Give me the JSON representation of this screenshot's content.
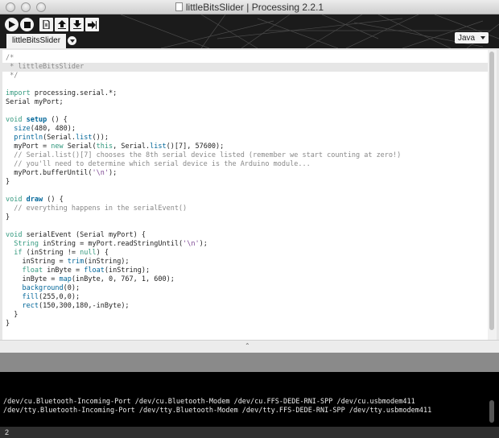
{
  "window": {
    "title": "littleBitsSlider | Processing 2.2.1"
  },
  "toolbar": {
    "buttons": [
      "run",
      "stop",
      "new",
      "open",
      "save",
      "export"
    ],
    "mode": "Java"
  },
  "tab": {
    "label": "littleBitsSlider"
  },
  "code": [
    [
      {
        "t": "/*",
        "c": "comment"
      }
    ],
    [
      {
        "t": " * littleBitsSlider",
        "c": "comment"
      }
    ],
    [
      {
        "t": " */",
        "c": "comment"
      }
    ],
    [],
    [
      {
        "t": "import",
        "c": "kw"
      },
      {
        "t": " processing.serial.*;",
        "c": "plain"
      }
    ],
    [
      {
        "t": "Serial myPort;",
        "c": "plain"
      }
    ],
    [],
    [
      {
        "t": "void",
        "c": "kw"
      },
      {
        "t": " ",
        "c": "plain"
      },
      {
        "t": "setup",
        "c": "fn"
      },
      {
        "t": " () {",
        "c": "plain"
      }
    ],
    [
      {
        "t": "  ",
        "c": "plain"
      },
      {
        "t": "size",
        "c": "builtin"
      },
      {
        "t": "(480, 480);",
        "c": "plain"
      }
    ],
    [
      {
        "t": "  ",
        "c": "plain"
      },
      {
        "t": "println",
        "c": "builtin"
      },
      {
        "t": "(Serial.",
        "c": "plain"
      },
      {
        "t": "list",
        "c": "builtin"
      },
      {
        "t": "());",
        "c": "plain"
      }
    ],
    [
      {
        "t": "  myPort = ",
        "c": "plain"
      },
      {
        "t": "new",
        "c": "kw"
      },
      {
        "t": " Serial(",
        "c": "plain"
      },
      {
        "t": "this",
        "c": "kw"
      },
      {
        "t": ", Serial.",
        "c": "plain"
      },
      {
        "t": "list",
        "c": "builtin"
      },
      {
        "t": "()[7], 57600);",
        "c": "plain"
      }
    ],
    [
      {
        "t": "  // Serial.list()[7] chooses the 8th serial device listed (remember we start counting at zero!)",
        "c": "comment"
      }
    ],
    [
      {
        "t": "  // you'll need to determine which serial device is the Arduino module...",
        "c": "comment"
      }
    ],
    [
      {
        "t": "  myPort.bufferUntil(",
        "c": "plain"
      },
      {
        "t": "'\\n'",
        "c": "str"
      },
      {
        "t": ");",
        "c": "plain"
      }
    ],
    [
      {
        "t": "}",
        "c": "plain"
      }
    ],
    [],
    [
      {
        "t": "void",
        "c": "kw"
      },
      {
        "t": " ",
        "c": "plain"
      },
      {
        "t": "draw",
        "c": "fn"
      },
      {
        "t": " () {",
        "c": "plain"
      }
    ],
    [
      {
        "t": "  // everything happens in the serialEvent()",
        "c": "comment"
      }
    ],
    [
      {
        "t": "}",
        "c": "plain"
      }
    ],
    [],
    [
      {
        "t": "void",
        "c": "kw"
      },
      {
        "t": " serialEvent (Serial myPort) {",
        "c": "plain"
      }
    ],
    [
      {
        "t": "  ",
        "c": "plain"
      },
      {
        "t": "String",
        "c": "kw"
      },
      {
        "t": " inString = myPort.readStringUntil(",
        "c": "plain"
      },
      {
        "t": "'\\n'",
        "c": "str"
      },
      {
        "t": ");",
        "c": "plain"
      }
    ],
    [
      {
        "t": "  ",
        "c": "plain"
      },
      {
        "t": "if",
        "c": "kw"
      },
      {
        "t": " (inString != ",
        "c": "plain"
      },
      {
        "t": "null",
        "c": "kw"
      },
      {
        "t": ") {",
        "c": "plain"
      }
    ],
    [
      {
        "t": "    inString = ",
        "c": "plain"
      },
      {
        "t": "trim",
        "c": "builtin"
      },
      {
        "t": "(inString);",
        "c": "plain"
      }
    ],
    [
      {
        "t": "    ",
        "c": "plain"
      },
      {
        "t": "float",
        "c": "kw"
      },
      {
        "t": " inByte = ",
        "c": "plain"
      },
      {
        "t": "float",
        "c": "builtin"
      },
      {
        "t": "(inString);",
        "c": "plain"
      }
    ],
    [
      {
        "t": "    inByte = ",
        "c": "plain"
      },
      {
        "t": "map",
        "c": "builtin"
      },
      {
        "t": "(inByte, 0, 767, 1, 600);",
        "c": "plain"
      }
    ],
    [
      {
        "t": "    ",
        "c": "plain"
      },
      {
        "t": "background",
        "c": "builtin"
      },
      {
        "t": "(0);",
        "c": "plain"
      }
    ],
    [
      {
        "t": "    ",
        "c": "plain"
      },
      {
        "t": "fill",
        "c": "builtin"
      },
      {
        "t": "(255,0,0);",
        "c": "plain"
      }
    ],
    [
      {
        "t": "    ",
        "c": "plain"
      },
      {
        "t": "rect",
        "c": "builtin"
      },
      {
        "t": "(150,300,180,-inByte);",
        "c": "plain"
      }
    ],
    [
      {
        "t": "  }",
        "c": "plain"
      }
    ],
    [
      {
        "t": "}",
        "c": "plain"
      }
    ]
  ],
  "highlight_line": 1,
  "console": {
    "lines": [
      "/dev/cu.Bluetooth-Incoming-Port /dev/cu.Bluetooth-Modem /dev/cu.FFS-DEDE-RNI-SPP /dev/cu.usbmodem411",
      "/dev/tty.Bluetooth-Incoming-Port /dev/tty.Bluetooth-Modem /dev/tty.FFS-DEDE-RNI-SPP /dev/tty.usbmodem411"
    ]
  },
  "footer": {
    "line_number": "2"
  },
  "colors": {
    "kw": "#33997e",
    "fn": "#006699",
    "builtin": "#006699",
    "comment": "#888888",
    "str": "#7d4793",
    "plain": "#222222"
  }
}
